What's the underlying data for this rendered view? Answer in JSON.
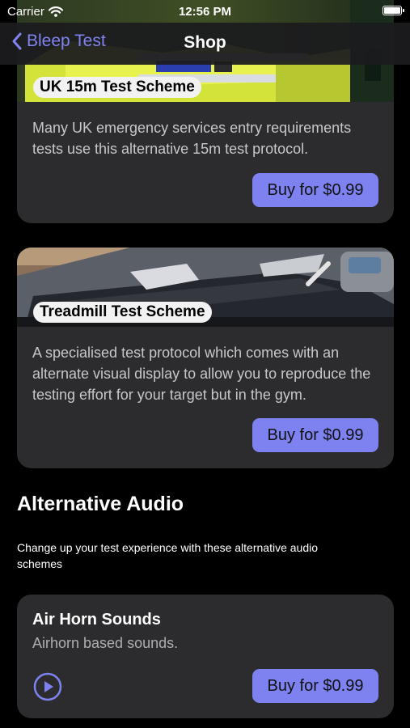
{
  "status_bar": {
    "carrier": "Carrier",
    "time": "12:56 PM"
  },
  "nav": {
    "back_label": "Bleep Test",
    "title": "Shop"
  },
  "schemes": [
    {
      "label": "UK 15m Test Scheme",
      "description": "Many UK emergency services entry requirements tests use this alternative 15m test protocol.",
      "buy_label": "Buy for $0.99"
    },
    {
      "label": "Treadmill Test Scheme",
      "description": "A specialised test protocol which comes with an alternate visual display to allow you to reproduce the testing effort for your target but in the gym.",
      "buy_label": "Buy for $0.99"
    }
  ],
  "audio_section": {
    "title": "Alternative Audio",
    "subtitle": "Change up your test experience with these alternative audio schemes",
    "items": [
      {
        "title": "Air Horn Sounds",
        "description": "Airhorn based sounds.",
        "buy_label": "Buy for $0.99"
      }
    ]
  },
  "colors": {
    "accent": "#7d82f0",
    "card": "#2c2c2e",
    "background": "#000000"
  },
  "icons": {
    "back": "chevron-left-icon",
    "wifi": "wifi-icon",
    "battery": "battery-icon",
    "play": "play-circle-icon"
  }
}
